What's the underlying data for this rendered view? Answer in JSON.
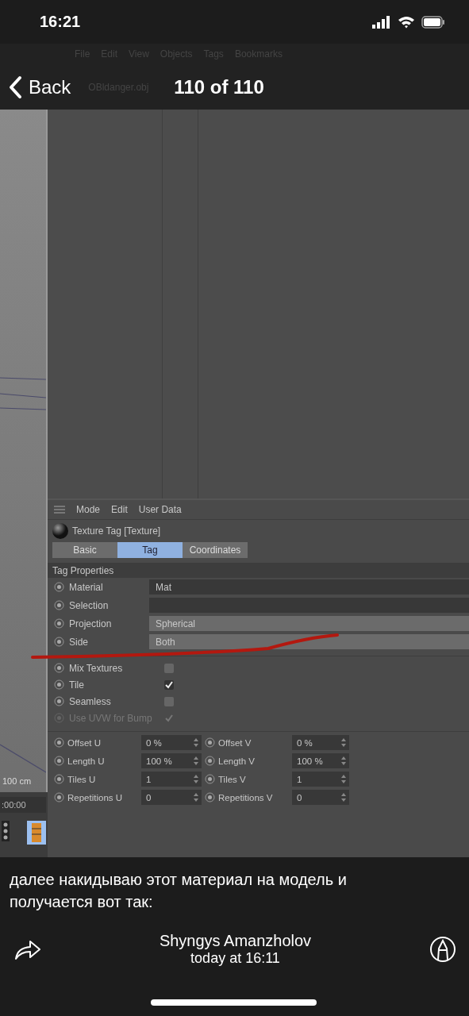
{
  "status_bar": {
    "time": "16:21"
  },
  "app_menu": [
    "File",
    "Edit",
    "View",
    "Objects",
    "Tags",
    "Bookmarks"
  ],
  "nav": {
    "back": "Back",
    "object_name": "OBldanger.obj",
    "title": "110 of 110"
  },
  "viewport": {
    "scale_label": "100 cm",
    "time_field": ":00:00"
  },
  "attributes": {
    "menu": [
      "Mode",
      "Edit",
      "User Data"
    ],
    "title": "Texture Tag [Texture]",
    "tabs": [
      {
        "label": "Basic",
        "selected": false
      },
      {
        "label": "Tag",
        "selected": true
      },
      {
        "label": "Coordinates",
        "selected": false
      }
    ],
    "section": "Tag Properties",
    "fields": [
      {
        "label": "Material",
        "value": "Mat",
        "kind": "link"
      },
      {
        "label": "Selection",
        "kind": "link"
      },
      {
        "label": "Projection",
        "value": "Spherical",
        "kind": "dropdown"
      },
      {
        "label": "Side",
        "value": "Both",
        "kind": "dropdown"
      }
    ],
    "checkboxes": [
      {
        "label": "Mix Textures",
        "checked": false,
        "disabled": false
      },
      {
        "label": "Tile",
        "checked": true,
        "disabled": false
      },
      {
        "label": "Seamless",
        "checked": false,
        "disabled": false
      },
      {
        "label": "Use UVW for Bump",
        "checked": true,
        "disabled": true
      }
    ],
    "numeric": [
      {
        "label": "Offset U",
        "value": "0 %"
      },
      {
        "label": "Offset V",
        "value": "0 %"
      },
      {
        "label": "Length U",
        "value": "100 %"
      },
      {
        "label": "Length V",
        "value": "100 %"
      },
      {
        "label": "Tiles U",
        "value": "1"
      },
      {
        "label": "Tiles V",
        "value": "1"
      },
      {
        "label": "Repetitions U",
        "value": "0"
      },
      {
        "label": "Repetitions V",
        "value": "0"
      }
    ]
  },
  "caption": {
    "text": "далее накидываю этот материал на модель и получается вот так:",
    "author": "Shyngys Amanzholov",
    "time": "today at 16:11"
  }
}
